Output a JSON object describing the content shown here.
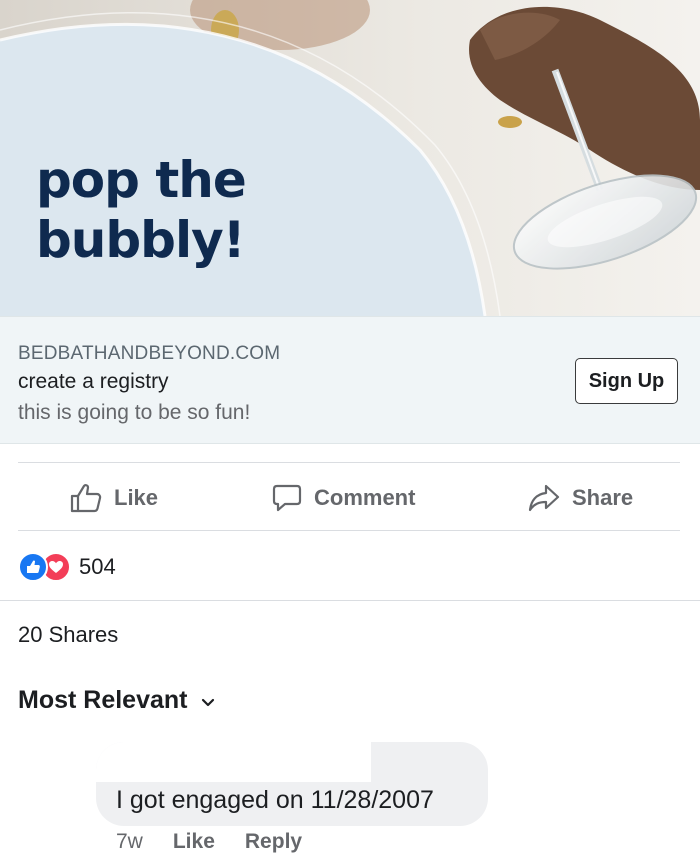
{
  "ad": {
    "headline": "pop the\nbubbly!"
  },
  "link_card": {
    "domain": "BEDBATHANDBEYOND.COM",
    "title": "create a registry",
    "description": "this is going to be so fun!",
    "cta_label": "Sign Up"
  },
  "actions": {
    "like_label": "Like",
    "comment_label": "Comment",
    "share_label": "Share"
  },
  "stats": {
    "reaction_count": "504",
    "shares_text": "20 Shares"
  },
  "comments": {
    "sort_label": "Most Relevant",
    "items": [
      {
        "text": "I got engaged on 11/28/2007",
        "time": "7w",
        "like_label": "Like",
        "reply_label": "Reply"
      }
    ]
  },
  "colors": {
    "headline": "#0f2a4f",
    "ad_panel": "#dce7ef",
    "link_card_bg": "#f0f5f7",
    "like_blue": "#1877f2",
    "love_red": "#f33e58",
    "secondary_text": "#65676b"
  },
  "icons": {
    "like": "thumbs-up-icon",
    "comment": "speech-bubble-icon",
    "share": "share-arrow-icon",
    "sort": "chevron-down-icon"
  }
}
